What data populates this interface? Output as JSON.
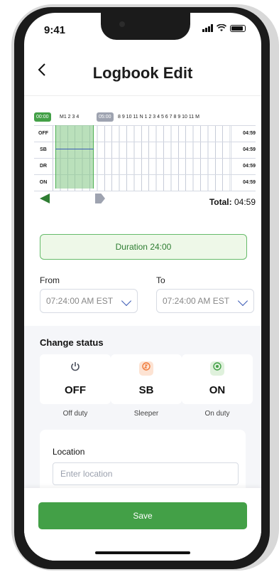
{
  "status_bar": {
    "time": "9:41"
  },
  "header": {
    "back_icon": "chevron-left-icon",
    "title": "Logbook Edit"
  },
  "grid": {
    "start_badge": "00:00",
    "end_badge": "05:00",
    "hour_labels_left": "M1  2  3  4",
    "hour_labels_right": "8  9 10 11  N  1  2  3  4  5  6  7  8  9 10 11 M",
    "rows": [
      {
        "label": "OFF",
        "total": "04:59"
      },
      {
        "label": "SB",
        "total": "04:59"
      },
      {
        "label": "DR",
        "total": "04:59"
      },
      {
        "label": "ON",
        "total": "04:59"
      }
    ],
    "total_label": "Total:",
    "total_value": "04:59"
  },
  "duration": {
    "text": "Duration 24:00"
  },
  "range": {
    "from_label": "From",
    "to_label": "To",
    "from_value": "07:24:00 AM EST",
    "to_value": "07:24:00 AM EST"
  },
  "change_status": {
    "title": "Change status",
    "options": [
      {
        "code": "OFF",
        "sub": "Off duty",
        "icon": "power-icon",
        "color": "#4a4f5c"
      },
      {
        "code": "SB",
        "sub": "Sleeper",
        "icon": "sleeper-icon",
        "color": "#f07a3a"
      },
      {
        "code": "ON",
        "sub": "On duty",
        "icon": "target-icon",
        "color": "#43a047"
      }
    ]
  },
  "location": {
    "label": "Location",
    "placeholder": "Enter location"
  },
  "actions": {
    "save_label": "Save"
  },
  "colors": {
    "accent": "#43a047",
    "selection": "#81c784",
    "handle_gray": "#9ea3b0"
  }
}
